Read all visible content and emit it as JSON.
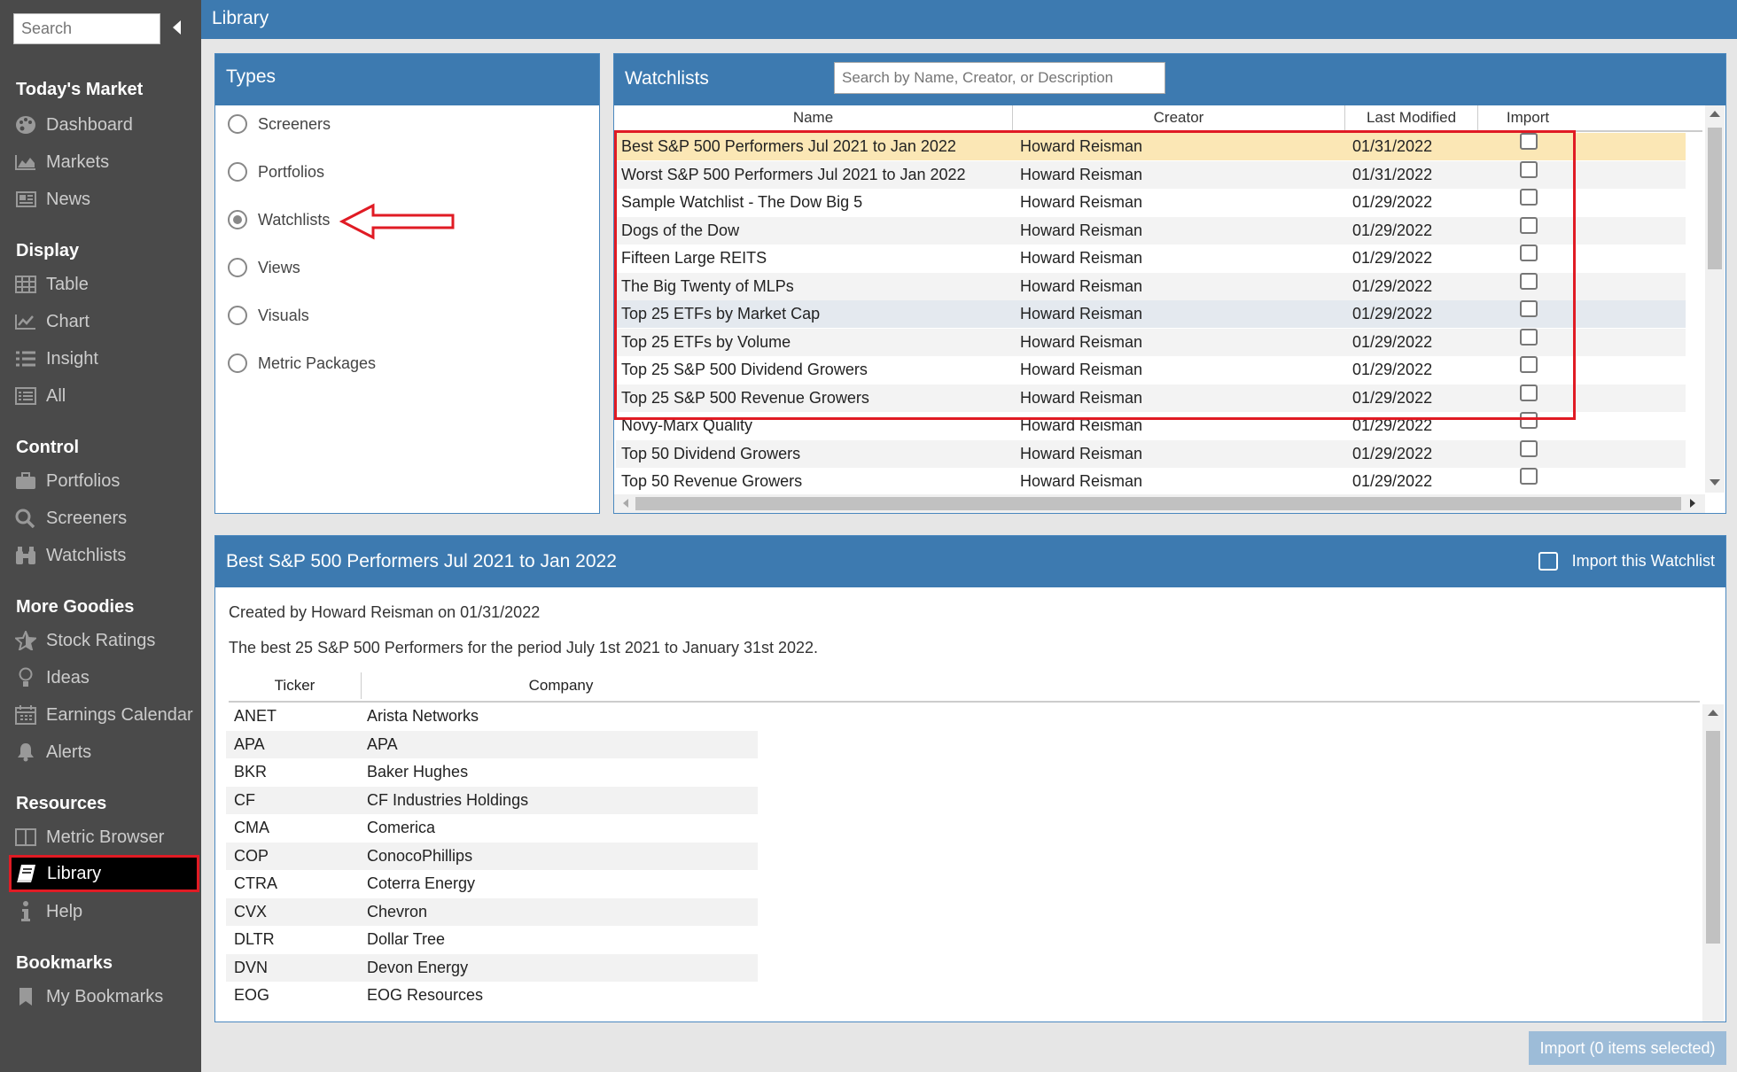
{
  "sidebar": {
    "search_placeholder": "Search",
    "sections": [
      {
        "title": "Today's Market",
        "items": [
          {
            "label": "Dashboard",
            "icon": "palette-icon"
          },
          {
            "label": "Markets",
            "icon": "area-chart-icon"
          },
          {
            "label": "News",
            "icon": "newspaper-icon"
          }
        ]
      },
      {
        "title": "Display",
        "items": [
          {
            "label": "Table",
            "icon": "table-icon"
          },
          {
            "label": "Chart",
            "icon": "line-chart-icon"
          },
          {
            "label": "Insight",
            "icon": "list-icon"
          },
          {
            "label": "All",
            "icon": "list-alt-icon"
          }
        ]
      },
      {
        "title": "Control",
        "items": [
          {
            "label": "Portfolios",
            "icon": "briefcase-icon"
          },
          {
            "label": "Screeners",
            "icon": "search-icon"
          },
          {
            "label": "Watchlists",
            "icon": "binoculars-icon"
          }
        ]
      },
      {
        "title": "More Goodies",
        "items": [
          {
            "label": "Stock Ratings",
            "icon": "star-icon"
          },
          {
            "label": "Ideas",
            "icon": "lightbulb-icon"
          },
          {
            "label": "Earnings Calendar",
            "icon": "calendar-icon"
          },
          {
            "label": "Alerts",
            "icon": "bell-icon"
          }
        ]
      },
      {
        "title": "Resources",
        "items": [
          {
            "label": "Metric Browser",
            "icon": "columns-icon"
          },
          {
            "label": "Library",
            "icon": "book-icon"
          },
          {
            "label": "Help",
            "icon": "info-icon"
          }
        ]
      },
      {
        "title": "Bookmarks",
        "items": [
          {
            "label": "My Bookmarks",
            "icon": "bookmark-icon"
          }
        ]
      }
    ]
  },
  "header": {
    "title": "Library"
  },
  "types": {
    "title": "Types",
    "options": [
      "Screeners",
      "Portfolios",
      "Watchlists",
      "Views",
      "Visuals",
      "Metric Packages"
    ],
    "selected": "Watchlists"
  },
  "watchlists": {
    "title": "Watchlists",
    "search_placeholder": "Search by Name, Creator, or Description",
    "columns": [
      "Name",
      "Creator",
      "Last Modified",
      "Import"
    ],
    "rows": [
      {
        "name": "Best S&P 500 Performers Jul 2021 to Jan 2022",
        "creator": "Howard Reisman",
        "modified": "01/31/2022"
      },
      {
        "name": "Worst S&P 500 Performers Jul 2021 to Jan 2022",
        "creator": "Howard Reisman",
        "modified": "01/31/2022"
      },
      {
        "name": "Sample Watchlist - The Dow Big 5",
        "creator": "Howard Reisman",
        "modified": "01/29/2022"
      },
      {
        "name": "Dogs of the Dow",
        "creator": "Howard Reisman",
        "modified": "01/29/2022"
      },
      {
        "name": "Fifteen Large REITS",
        "creator": "Howard Reisman",
        "modified": "01/29/2022"
      },
      {
        "name": "The Big Twenty of MLPs",
        "creator": "Howard Reisman",
        "modified": "01/29/2022"
      },
      {
        "name": "Top 25 ETFs by Market Cap",
        "creator": "Howard Reisman",
        "modified": "01/29/2022"
      },
      {
        "name": "Top 25 ETFs by Volume",
        "creator": "Howard Reisman",
        "modified": "01/29/2022"
      },
      {
        "name": "Top 25 S&P 500 Dividend Growers",
        "creator": "Howard Reisman",
        "modified": "01/29/2022"
      },
      {
        "name": "Top 25 S&P 500 Revenue Growers",
        "creator": "Howard Reisman",
        "modified": "01/29/2022"
      },
      {
        "name": "Novy-Marx Quality",
        "creator": "Howard Reisman",
        "modified": "01/29/2022"
      },
      {
        "name": "Top 50 Dividend Growers",
        "creator": "Howard Reisman",
        "modified": "01/29/2022"
      },
      {
        "name": "Top 50 Revenue Growers",
        "creator": "Howard Reisman",
        "modified": "01/29/2022"
      }
    ]
  },
  "detail": {
    "title": "Best S&P 500 Performers Jul 2021 to Jan 2022",
    "import_label": "Import this Watchlist",
    "created": "Created by Howard Reisman on 01/31/2022",
    "description": "The best 25 S&P 500 Performers for the period July 1st 2021 to January 31st 2022.",
    "columns": [
      "Ticker",
      "Company"
    ],
    "rows": [
      {
        "ticker": "ANET",
        "company": "Arista Networks"
      },
      {
        "ticker": "APA",
        "company": "APA"
      },
      {
        "ticker": "BKR",
        "company": "Baker Hughes"
      },
      {
        "ticker": "CF",
        "company": "CF Industries Holdings"
      },
      {
        "ticker": "CMA",
        "company": "Comerica"
      },
      {
        "ticker": "COP",
        "company": "ConocoPhillips"
      },
      {
        "ticker": "CTRA",
        "company": "Coterra Energy"
      },
      {
        "ticker": "CVX",
        "company": "Chevron"
      },
      {
        "ticker": "DLTR",
        "company": "Dollar Tree"
      },
      {
        "ticker": "DVN",
        "company": "Devon Energy"
      },
      {
        "ticker": "EOG",
        "company": "EOG Resources"
      }
    ]
  },
  "footer": {
    "import_button": "Import (0 items selected)"
  },
  "colors": {
    "accent": "#3d7ab0",
    "highlight": "#e01b24",
    "selected_row": "#fbe7b5"
  }
}
